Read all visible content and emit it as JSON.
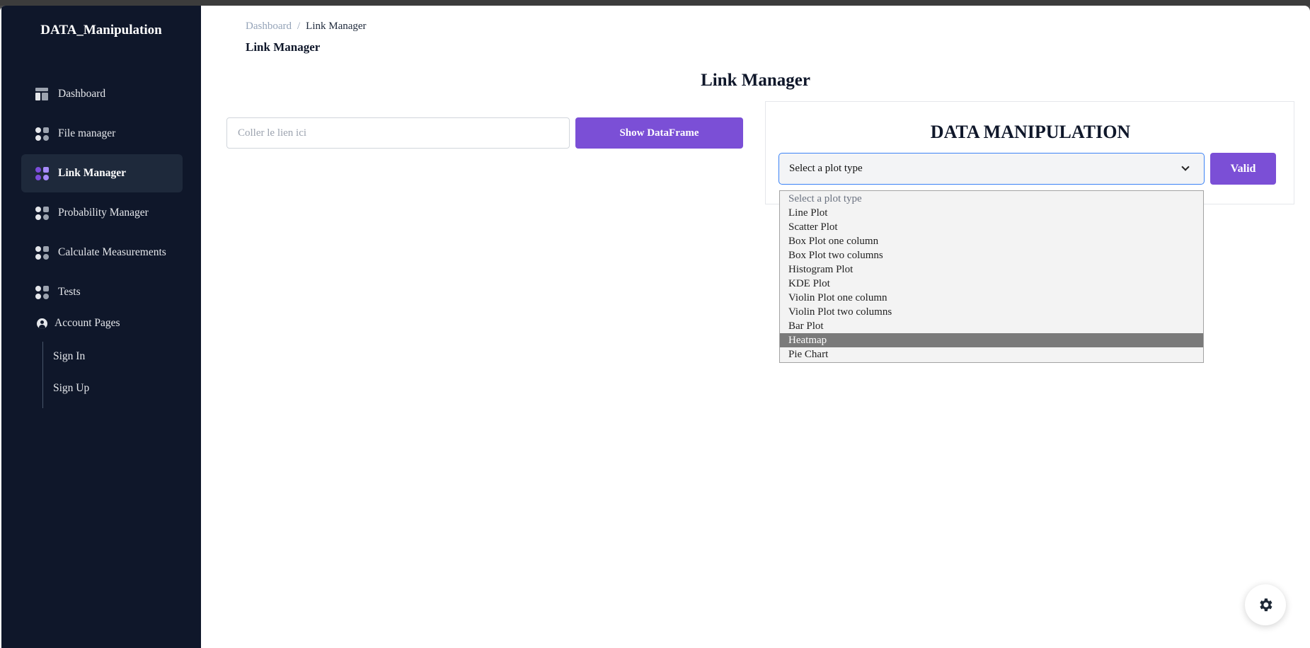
{
  "sidebar": {
    "brand": "DATA_Manipulation",
    "items": [
      {
        "label": "Dashboard",
        "icon": "dashboard-icon"
      },
      {
        "label": "File manager",
        "icon": "grid-icon"
      },
      {
        "label": "Link Manager",
        "icon": "grid-icon",
        "active": true
      },
      {
        "label": "Probability Manager",
        "icon": "grid-icon"
      },
      {
        "label": "Calculate Measurements",
        "icon": "grid-icon"
      },
      {
        "label": "Tests",
        "icon": "grid-icon"
      }
    ],
    "account": {
      "label": "Account Pages",
      "icon": "user-circle-icon",
      "children": [
        {
          "label": "Sign In"
        },
        {
          "label": "Sign Up"
        }
      ]
    }
  },
  "breadcrumb": {
    "parent": "Dashboard",
    "separator": "/",
    "current": "Link Manager"
  },
  "crumb_title": "Link Manager",
  "page_title": "Link Manager",
  "link_input": {
    "placeholder": "Coller le lien ici",
    "value": ""
  },
  "show_button": "Show DataFrame",
  "panel": {
    "title": "DATA MANIPULATION",
    "select_value": "Select a plot type",
    "valid_button": "Valid",
    "options": [
      "Select a plot type",
      "Line Plot",
      "Scatter Plot",
      "Box Plot one column",
      "Box Plot two columns",
      "Histogram Plot",
      "KDE Plot",
      "Violin Plot one column",
      "Violin Plot two columns",
      "Bar Plot",
      "Heatmap",
      "Pie Chart"
    ],
    "highlighted_option": "Heatmap"
  },
  "colors": {
    "sidebar_bg": "#0f172a",
    "accent": "#7b4fd6",
    "focus_border": "#3b82f6"
  },
  "fab_icon": "gear-icon"
}
